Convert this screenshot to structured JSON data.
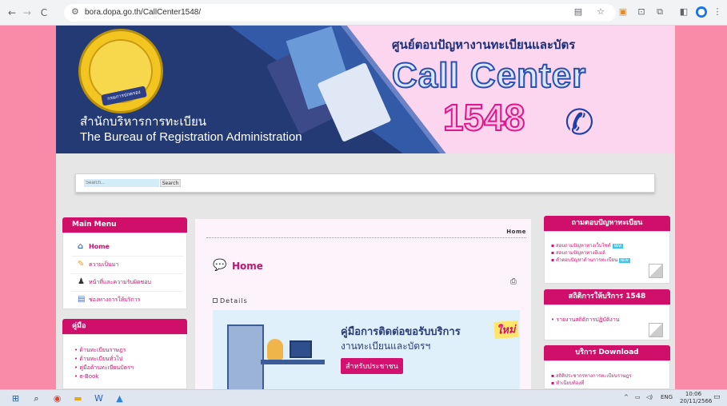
{
  "browser": {
    "url": "bora.dopa.go.th/CallCenter1548/",
    "back_icon": "arrow-left-icon",
    "forward_icon": "arrow-right-icon",
    "reload_icon": "reload-icon",
    "site_info_icon": "tune-icon",
    "toolbar_icons": [
      "translate-icon",
      "star-icon",
      "extension-orange-icon",
      "screenshot-icon",
      "extensions-icon",
      "sidepanel-icon",
      "profile-icon",
      "menu-dots-icon"
    ]
  },
  "banner": {
    "title_th": "สำนักบริหารการทะเบียน",
    "title_en": "The Bureau of Registration Administration",
    "center_th": "ศูนย์ตอบปัญหางานทะเบียนและบัตร",
    "call_center": "Call Center",
    "number": "1548",
    "emblem_text": "กรมการปกครอง",
    "phone_icon": "phone-icon"
  },
  "search": {
    "placeholder": "Search...",
    "button": "Search"
  },
  "left": {
    "main_menu_title": "Main Menu",
    "menu": [
      {
        "label": "Home",
        "icon": "home-icon"
      },
      {
        "label": "ความเป็นมา",
        "icon": "pencil-icon"
      },
      {
        "label": "หน้าที่และความรับผิดชอบ",
        "icon": "person-icon"
      },
      {
        "label": "ช่องทางการให้บริการ",
        "icon": "document-icon"
      }
    ],
    "manual_title": "คู่มือ",
    "manual_items": [
      "ด้านทะเบียนราษฎร",
      "ด้านทะเบียนทั่วไป",
      "คู่มือด้านทะเบียนบัตรฯ",
      "e-Book"
    ]
  },
  "center": {
    "breadcrumb": "Home",
    "title": "Home",
    "details": "Details",
    "print_icon": "print-icon",
    "card": {
      "line1": "คู่มือการติดต่อขอรับบริการ",
      "line2": "งานทะเบียนและบัตรฯ",
      "tag": "สำหรับประชาชน",
      "new": "ใหม่"
    }
  },
  "right": {
    "faq_title": "ถามตอบปัญหาทะเบียน",
    "faq_items": [
      "สอบถามปัญหาทางเว็บไซต์",
      "สอบถามปัญหาทางอีเมล์",
      "คำตอบปัญหาด้านการทะเบียน"
    ],
    "new_badge": "NEW",
    "stats_title": "สถิติการให้บริการ 1548",
    "stats_items": [
      "รายงานสถิติการปฏิบัติงาน"
    ],
    "download_title": "บริการ Download",
    "download_items": [
      "สถิติประชากรทางการทะเบียนราษฎร",
      "ทำเนียบท้องที่"
    ]
  },
  "taskbar": {
    "icons": [
      "windows-icon",
      "search-icon",
      "chrome-icon",
      "file-explorer-icon",
      "word-icon",
      "photos-icon"
    ],
    "lang": "ENG",
    "time": "10:06",
    "date": "20/11/2566"
  }
}
